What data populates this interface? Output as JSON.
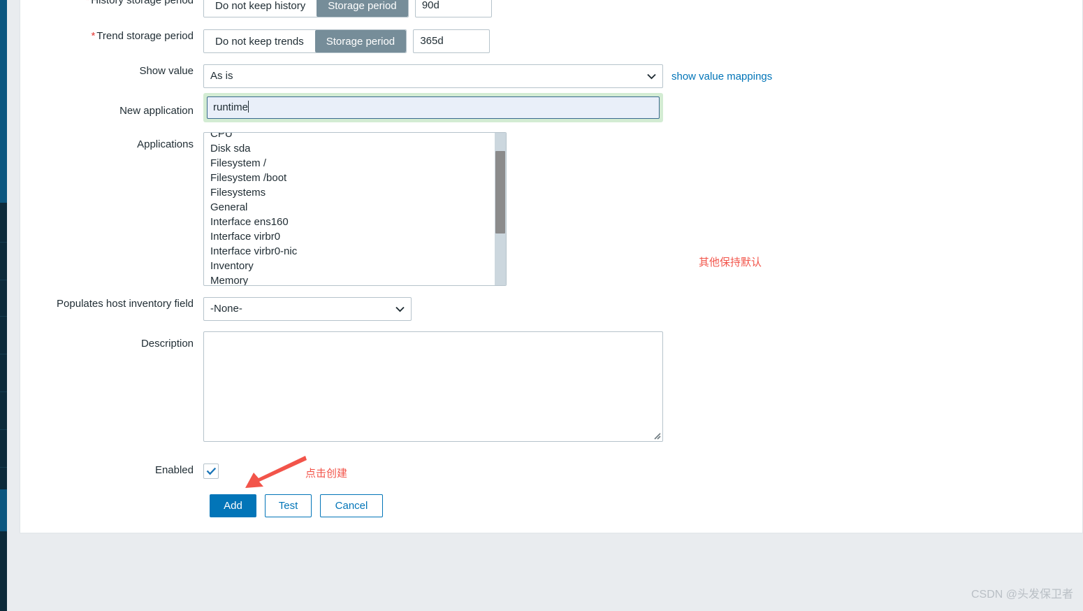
{
  "colors": {
    "accent": "#0275b8",
    "segment_selected_bg": "#768d99",
    "required_asterisk": "#e33734",
    "focus_ring": "#d3ecd3",
    "annotation_red": "#f2544a",
    "sidebar_top": "#0c567f",
    "sidebar_bottom": "#0d2a3a",
    "page_bg": "#e9ecef"
  },
  "form": {
    "history_storage_period": {
      "label": "History storage period",
      "required": true,
      "options": [
        "Do not keep history",
        "Storage period"
      ],
      "selected": "Storage period",
      "value": "90d"
    },
    "trend_storage_period": {
      "label": "Trend storage period",
      "required": true,
      "options": [
        "Do not keep trends",
        "Storage period"
      ],
      "selected": "Storage period",
      "value": "365d"
    },
    "show_value": {
      "label": "Show value",
      "value": "As is",
      "link_label": "show value mappings"
    },
    "new_application": {
      "label": "New application",
      "value": "runtime",
      "focused": true
    },
    "applications": {
      "label": "Applications",
      "options": [
        "CPU",
        "Disk sda",
        "Filesystem /",
        "Filesystem /boot",
        "Filesystems",
        "General",
        "Interface ens160",
        "Interface virbr0",
        "Interface virbr0-nic",
        "Inventory",
        "Memory"
      ]
    },
    "host_inventory_field": {
      "label": "Populates host inventory field",
      "value": "-None-"
    },
    "description": {
      "label": "Description",
      "value": "",
      "placeholder": ""
    },
    "enabled": {
      "label": "Enabled",
      "checked": true
    }
  },
  "footer_buttons": {
    "add": "Add",
    "test": "Test",
    "cancel": "Cancel"
  },
  "annotations": {
    "keep_defaults": "其他保持默认",
    "click_create": "点击创建"
  },
  "watermark": "CSDN @头发保卫者"
}
